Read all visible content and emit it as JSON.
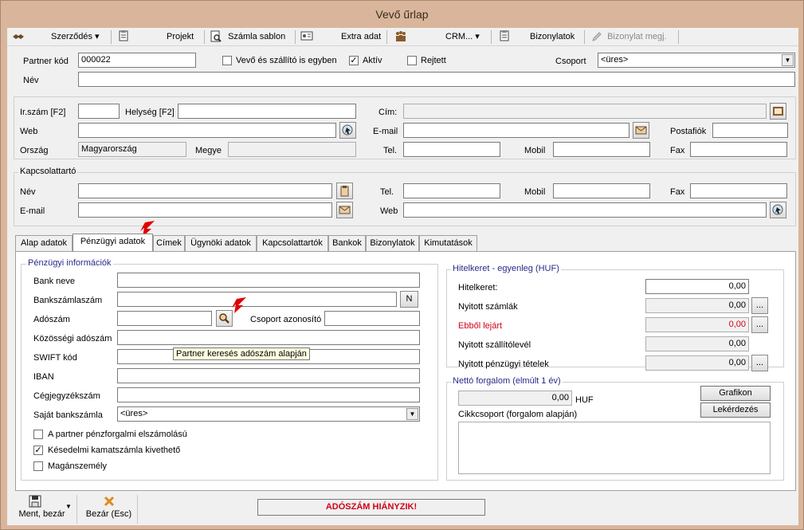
{
  "window": {
    "title": "Vevő űrlap"
  },
  "toolbar": {
    "contract": "Szerződés",
    "project": "Projekt",
    "invoice_template": "Számla sablon",
    "extra_data": "Extra adat",
    "crm": "CRM...",
    "documents": "Bizonylatok",
    "doc_view": "Bizonylat megj."
  },
  "header": {
    "partner_code_label": "Partner kód",
    "partner_code": "000022",
    "same_buyer_shipper": "Vevő és szállító is egyben",
    "active": "Aktív",
    "hidden": "Rejtett",
    "group_label": "Csoport",
    "group_value": "<üres>",
    "name_label": "Név",
    "name": ""
  },
  "address": {
    "zip_label": "Ir.szám [F2]",
    "zip": "",
    "city_label": "Helység [F2]",
    "city": "",
    "address_label": "Cím:",
    "address": "",
    "web_label": "Web",
    "web": "",
    "email_label": "E-mail",
    "email": "",
    "pobox_label": "Postafiók",
    "pobox": "",
    "country_label": "Ország",
    "country": "Magyarország",
    "county_label": "Megye",
    "county": "",
    "phone_label": "Tel.",
    "phone": "",
    "mobile_label": "Mobil",
    "mobile": "",
    "fax_label": "Fax",
    "fax": ""
  },
  "contact": {
    "title": "Kapcsolattartó",
    "name_label": "Név",
    "name": "",
    "phone_label": "Tel.",
    "phone": "",
    "mobile_label": "Mobil",
    "mobile": "",
    "fax_label": "Fax",
    "fax": "",
    "email_label": "E-mail",
    "email": "",
    "web_label": "Web",
    "web": ""
  },
  "tabs": [
    "Alap adatok",
    "Pénzügyi adatok",
    "Címek",
    "Ügynöki adatok",
    "Kapcsolattartók",
    "Bankok",
    "Bizonylatok",
    "Kimutatások"
  ],
  "active_tab": "Pénzügyi adatok",
  "finance": {
    "title": "Pénzügyi információk",
    "bank_name_label": "Bank neve",
    "bank_name": "",
    "bank_account_label": "Bankszámlaszám",
    "bank_account": "",
    "bank_account_btn": "N",
    "tax_number_label": "Adószám",
    "tax_number": "",
    "group_id_label": "Csoport azonosító",
    "group_id": "",
    "eu_tax_label": "Közösségi adószám",
    "eu_tax": "",
    "swift_label": "SWIFT kód",
    "swift": "",
    "iban_label": "IBAN",
    "iban": "",
    "company_reg_label": "Cégjegyzékszám",
    "company_reg": "",
    "own_account_label": "Saját bankszámla",
    "own_account": "<üres>",
    "cash_accounting": "A partner pénzforgalmi elszámolású",
    "late_interest": "Késedelmi kamatszámla kivethető",
    "private_person": "Magánszemély",
    "tooltip": "Partner keresés adószám alapján"
  },
  "credit": {
    "title": "Hitelkeret - egyenleg (HUF)",
    "limit_label": "Hitelkeret:",
    "limit": "0,00",
    "open_invoices_label": "Nyitott számlák",
    "open_invoices": "0,00",
    "overdue_label": "Ebből lejárt",
    "overdue": "0,00",
    "open_delivery_label": "Nyitott szállítólevél",
    "open_delivery": "0,00",
    "open_finance_label": "Nyitott pénzügyi tételek",
    "open_finance": "0,00",
    "ellipsis": "..."
  },
  "turnover": {
    "title": "Nettó forgalom (elmúlt 1 év)",
    "value": "0,00",
    "currency": "HUF",
    "chart_btn": "Grafikon",
    "query_btn": "Lekérdezés",
    "article_group_label": "Cikkcsoport (forgalom alapján)"
  },
  "footer": {
    "save_close": "Ment, bezár",
    "close": "Bezár (Esc)",
    "status": "ADÓSZÁM HIÁNYZIK!"
  },
  "colors": {
    "accent_red": "#d0021b",
    "title_bg": "#d9b69b",
    "group_title": "#2a2a8a"
  }
}
